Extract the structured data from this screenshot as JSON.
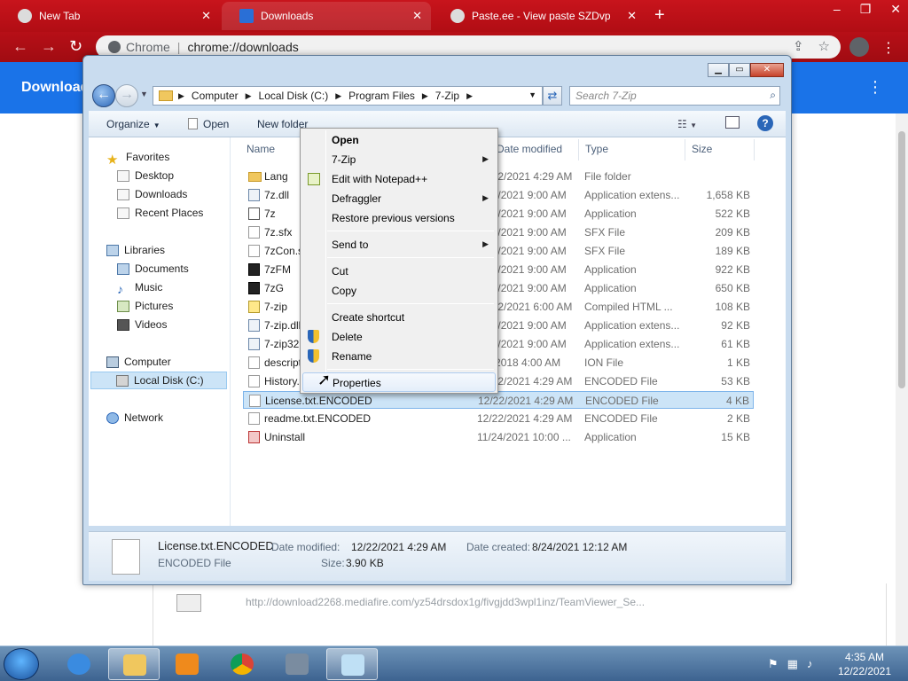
{
  "browser": {
    "tabs": [
      {
        "label": "New Tab"
      },
      {
        "label": "Downloads"
      },
      {
        "label": "Paste.ee - View paste SZDvp"
      }
    ],
    "omnibox_chip": "Chrome",
    "omnibox_url": "chrome://downloads",
    "page_title": "Download",
    "download_url": "http://download2268.mediafire.com/yz54drsdox1g/fivgjdd3wpl1inz/TeamViewer_Se..."
  },
  "explorer": {
    "breadcrumbs": [
      "Computer",
      "Local Disk (C:)",
      "Program Files",
      "7-Zip"
    ],
    "search_placeholder": "Search 7-Zip",
    "commands": {
      "organize": "Organize",
      "open": "Open",
      "new_folder": "New folder"
    },
    "nav": {
      "favorites": "Favorites",
      "favorites_items": [
        "Desktop",
        "Downloads",
        "Recent Places"
      ],
      "libraries": "Libraries",
      "libraries_items": [
        "Documents",
        "Music",
        "Pictures",
        "Videos"
      ],
      "computer": "Computer",
      "computer_items": [
        "Local Disk (C:)"
      ],
      "network": "Network"
    },
    "columns": {
      "name": "Name",
      "date": "Date modified",
      "type": "Type",
      "size": "Size"
    },
    "files": [
      {
        "name": "Lang",
        "date": "12/22/2021 4:29 AM",
        "type": "File folder",
        "size": ""
      },
      {
        "name": "7z.dll",
        "date": "8/24/2021 9:00 AM",
        "type": "Application extens...",
        "size": "1,658 KB"
      },
      {
        "name": "7z",
        "date": "8/24/2021 9:00 AM",
        "type": "Application",
        "size": "522 KB"
      },
      {
        "name": "7z.sfx",
        "date": "8/24/2021 9:00 AM",
        "type": "SFX File",
        "size": "209 KB"
      },
      {
        "name": "7zCon.sfx",
        "date": "8/24/2021 9:00 AM",
        "type": "SFX File",
        "size": "189 KB"
      },
      {
        "name": "7zFM",
        "date": "8/24/2021 9:00 AM",
        "type": "Application",
        "size": "922 KB"
      },
      {
        "name": "7zG",
        "date": "8/24/2021 9:00 AM",
        "type": "Application",
        "size": "650 KB"
      },
      {
        "name": "7-zip",
        "date": "12/22/2021 6:00 AM",
        "type": "Compiled HTML ...",
        "size": "108 KB"
      },
      {
        "name": "7-zip.dll",
        "date": "8/24/2021 9:00 AM",
        "type": "Application extens...",
        "size": "92 KB"
      },
      {
        "name": "7-zip32.dll",
        "date": "8/24/2021 9:00 AM",
        "type": "Application extens...",
        "size": "61 KB"
      },
      {
        "name": "descript.ion",
        "date": "9/2/2018 4:00 AM",
        "type": "ION File",
        "size": "1 KB"
      },
      {
        "name": "History.txt.ENCODED",
        "date": "12/22/2021 4:29 AM",
        "type": "ENCODED File",
        "size": "53 KB"
      },
      {
        "name": "License.txt.ENCODED",
        "date": "12/22/2021 4:29 AM",
        "type": "ENCODED File",
        "size": "4 KB"
      },
      {
        "name": "readme.txt.ENCODED",
        "date": "12/22/2021 4:29 AM",
        "type": "ENCODED File",
        "size": "2 KB"
      },
      {
        "name": "Uninstall",
        "date": "11/24/2021 10:00 ...",
        "type": "Application",
        "size": "15 KB"
      }
    ],
    "details": {
      "filename": "License.txt.ENCODED",
      "filetype": "ENCODED File",
      "modified_label": "Date modified:",
      "modified_value": "12/22/2021 4:29 AM",
      "created_label": "Date created:",
      "created_value": "8/24/2021 12:12 AM",
      "size_label": "Size:",
      "size_value": "3.90 KB"
    }
  },
  "context_menu": {
    "open": "Open",
    "sevenzip": "7-Zip",
    "notepad": "Edit with Notepad++",
    "defraggler": "Defraggler",
    "restore": "Restore previous versions",
    "sendto": "Send to",
    "cut": "Cut",
    "copy": "Copy",
    "shortcut": "Create shortcut",
    "delete": "Delete",
    "rename": "Rename",
    "properties": "Properties"
  },
  "taskbar": {
    "time": "4:35 AM",
    "date": "12/22/2021"
  }
}
